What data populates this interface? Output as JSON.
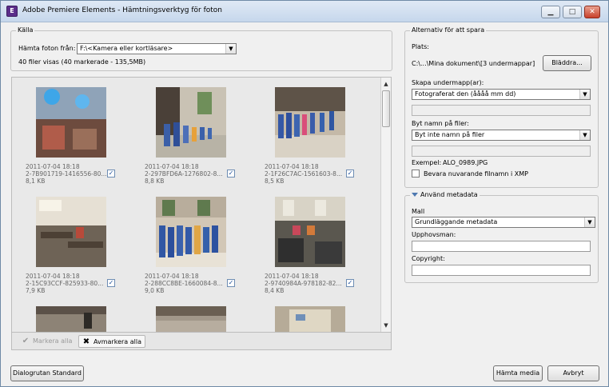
{
  "window": {
    "title": "Adobe Premiere Elements - Hämtningsverktyg för foton"
  },
  "source": {
    "group_label": "Källa",
    "fetch_from_label": "Hämta foton från:",
    "fetch_from_value": "F:\\<Kamera eller kortläsare>",
    "summary": "40 filer visas (40 markerade - 135,5MB)"
  },
  "photos": [
    {
      "date": "2011-07-04 18:18",
      "name": "2-7B901719-1416556-80...",
      "size": "8,1 KB",
      "checked": true
    },
    {
      "date": "2011-07-04 18:18",
      "name": "2-297BFD6A-1276802-8...",
      "size": "8,8 KB",
      "checked": true
    },
    {
      "date": "2011-07-04 18:18",
      "name": "2-1F26C7AC-1561603-8...",
      "size": "8,5 KB",
      "checked": true
    },
    {
      "date": "2011-07-04 18:18",
      "name": "2-15C93CCF-825933-80...",
      "size": "7,9 KB",
      "checked": true
    },
    {
      "date": "2011-07-04 18:18",
      "name": "2-288CC8BE-1660084-8...",
      "size": "9,0 KB",
      "checked": true
    },
    {
      "date": "2011-07-04 18:18",
      "name": "2-9740984A-978182-82...",
      "size": "8,4 KB",
      "checked": true
    }
  ],
  "gallery_toolbar": {
    "check_all": "Markera alla",
    "uncheck_all": "Avmarkera alla"
  },
  "save_options": {
    "group_label": "Alternativ för att spara",
    "location_label": "Plats:",
    "location_value": "C:\\...\\Mina dokument\\[3 undermappar]",
    "browse_label": "Bläddra...",
    "subfolder_label": "Skapa undermapp(ar):",
    "subfolder_value": "Fotograferat den (åååå mm dd)",
    "rename_label": "Byt namn på filer:",
    "rename_value": "Byt inte namn på filer",
    "example_label": "Exempel:",
    "example_value": "ALO_0989.JPG",
    "keep_filename_label": "Bevara nuvarande filnamn i XMP",
    "keep_filename_checked": false
  },
  "metadata": {
    "group_label": "Använd metadata",
    "template_label": "Mall",
    "template_value": "Grundläggande metadata",
    "author_label": "Upphovsman:",
    "copyright_label": "Copyright:"
  },
  "footer": {
    "standard_dialog": "Dialogrutan Standard",
    "get_media": "Hämta media",
    "cancel": "Avbryt"
  }
}
